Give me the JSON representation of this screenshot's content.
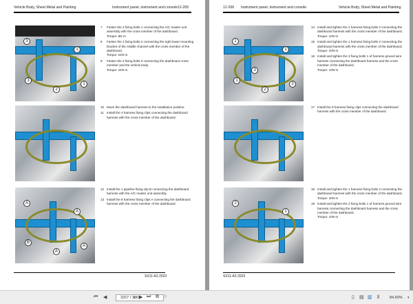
{
  "left_page": {
    "header_left": "Vehicle Body, Sheet Metal and Painting",
    "header_center": "Instrument panel, instrument and console",
    "header_page": "12-205",
    "footer": "SX11-A3  2023",
    "blocks": [
      {
        "callouts": [
          "3",
          "1",
          "3",
          "2",
          "1"
        ],
        "steps": [
          {
            "n": "7",
            "text": "Fasten the 2 fixing bolts 1 connecting the A/C master unit assembly with the cross member of the dashboard.",
            "torque": "Torque: 8N·m"
          },
          {
            "n": "8",
            "text": "Fasten the 2 fixing bolts 2 connecting the right lower mounting bracket of the middle channel with the cross member of the dashboard.",
            "torque": "Torque: 24N·m"
          },
          {
            "n": "9",
            "text": "Fasten the 2 fixing bolts 3 connecting the dashboard cross member and the vehicle body.",
            "torque": "Torque: 24N·m"
          }
        ]
      },
      {
        "callouts": [],
        "steps": [
          {
            "n": "10",
            "text": "Move the dashboard harness to the installation position.",
            "torque": ""
          },
          {
            "n": "11",
            "text": "Install the 4 harness fixing clips connecting the dashboard harness with the cross member of the dashboard.",
            "torque": ""
          }
        ]
      },
      {
        "callouts": [
          "A",
          "A",
          "B",
          "A",
          "A"
        ],
        "steps": [
          {
            "n": "12",
            "text": "Install the 1 pipeline fixing clip B connecting the dashboard harness with the A/C master unit assembly.",
            "torque": ""
          },
          {
            "n": "13",
            "text": "Install the 8 harness fixing clips A connecting the dashboard harness with the cross member of the dashboard.",
            "torque": ""
          }
        ]
      }
    ]
  },
  "right_page": {
    "header_page": "12-206",
    "header_center": "Instrument panel, instrument and console",
    "header_right": "Vehicle Body, Sheet Metal and Painting",
    "footer": "SX11-A3  2023",
    "blocks": [
      {
        "callouts": [
          "1",
          "1",
          "1",
          "2",
          "3",
          "3"
        ],
        "steps": [
          {
            "n": "14",
            "text": "Install and tighten the 2 harness fixing bolts 3 connecting the dashboard harness with the cross member of the dashboard.",
            "torque": "Torque: 10N·m"
          },
          {
            "n": "15",
            "text": "Install and tighten the 1 harness fixing bolts 2 connecting the dashboard harness with the cross member of the dashboard.",
            "torque": "Torque: 10N·m"
          },
          {
            "n": "16",
            "text": "Install and tighten the 3 fixing bolts 1 of harness ground wire harness connecting the dashboard harness and the cross member of the dashboard.",
            "torque": "Torque: 10N·m"
          }
        ]
      },
      {
        "callouts": [],
        "steps": [
          {
            "n": "17",
            "text": "Install the 9 harness fixing clips connecting the dashboard harness with the cross member of the dashboard.",
            "torque": ""
          }
        ]
      },
      {
        "callouts": [
          "2",
          "1"
        ],
        "steps": [
          {
            "n": "18",
            "text": "Install and tighten the 1 harness fixing bolts 2 connecting the dashboard harness with the cross member of the dashboard.",
            "torque": "Torque: 10N·m"
          },
          {
            "n": "19",
            "text": "Install and tighten the 2 fixing bolts 1 of harness ground wire harness connecting the dashboard harness and the cross member of the dashboard.",
            "torque": "Torque: 10N·m"
          }
        ]
      }
    ]
  },
  "toolbar": {
    "page_input": "3207 / 3365",
    "zoom": "84,40%"
  }
}
